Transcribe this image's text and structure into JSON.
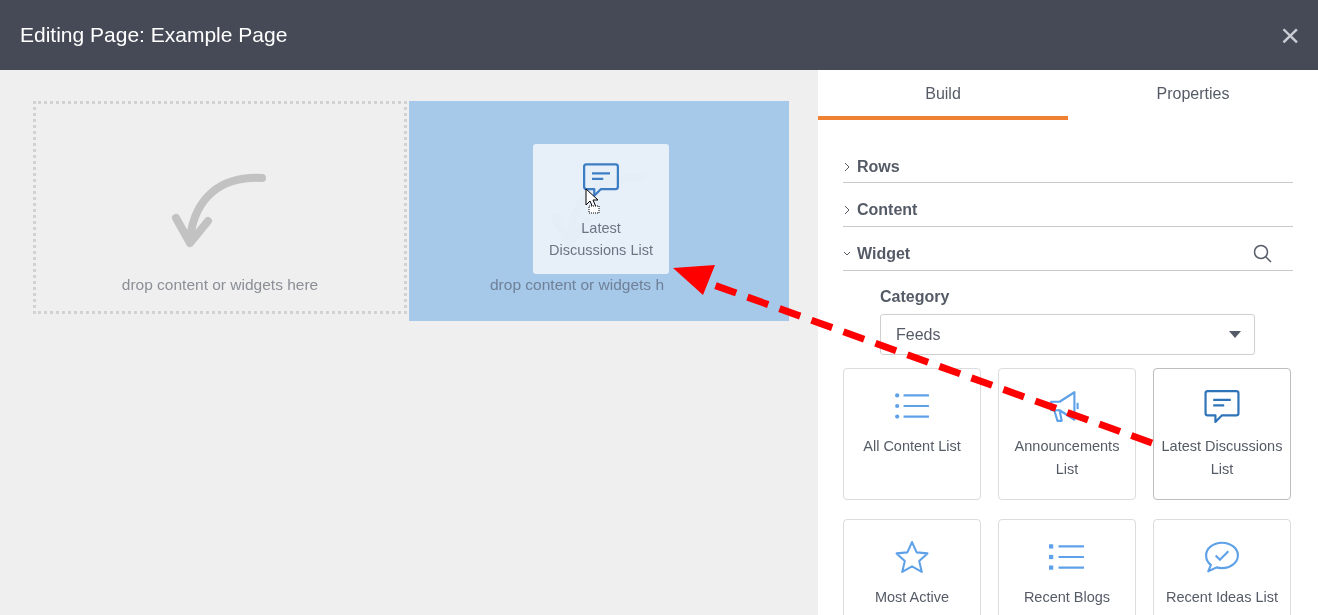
{
  "window": {
    "title": "Editing Page: Example Page",
    "close": "×"
  },
  "canvas": {
    "drop_zones": [
      {
        "text": "drop content or widgets here",
        "highlighted": false
      },
      {
        "text": "drop content or widgets h",
        "highlighted": true
      }
    ],
    "drag_preview": {
      "label": "Latest Discussions List"
    }
  },
  "panel": {
    "tabs": [
      {
        "label": "Build",
        "selected": true
      },
      {
        "label": "Properties",
        "selected": false
      }
    ],
    "sections": [
      {
        "title": "Rows",
        "expanded": false
      },
      {
        "title": "Content",
        "expanded": false
      },
      {
        "title": "Widget",
        "expanded": true
      }
    ],
    "category": {
      "label": "Category",
      "value": "Feeds"
    },
    "widgets": [
      {
        "label": "All Content List",
        "selected": false
      },
      {
        "label": "Announcements List",
        "selected": false
      },
      {
        "label": "Latest Discussions List",
        "selected": true
      },
      {
        "label": "Most Active",
        "selected": false
      },
      {
        "label": "Recent Blogs",
        "selected": false
      },
      {
        "label": "Recent Ideas List",
        "selected": false
      }
    ]
  }
}
